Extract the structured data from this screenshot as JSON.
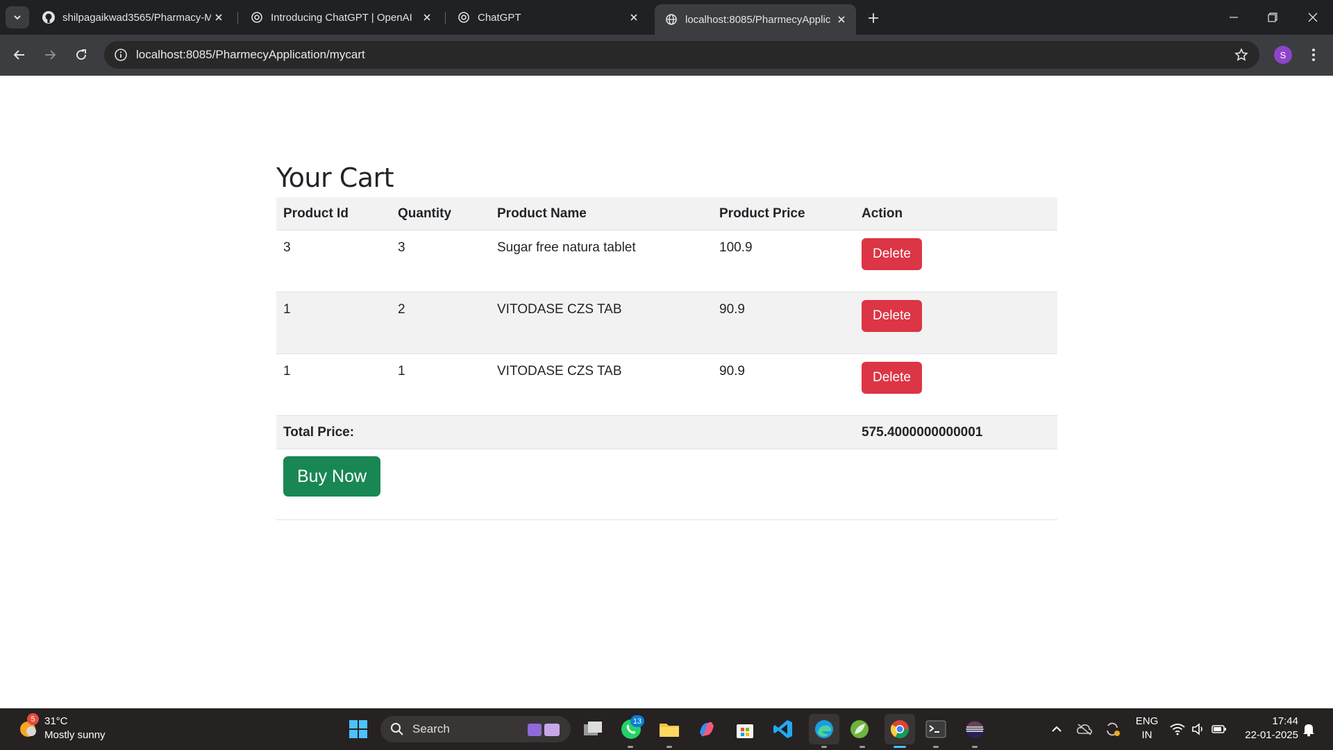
{
  "browser": {
    "tabs": [
      {
        "title": "shilpagaikwad3565/Pharmacy-M",
        "icon": "github-icon"
      },
      {
        "title": "Introducing ChatGPT | OpenAI",
        "icon": "openai-icon"
      },
      {
        "title": "ChatGPT",
        "icon": "openai-icon"
      },
      {
        "title": "localhost:8085/PharmecyApplic",
        "icon": "globe-icon"
      }
    ],
    "url": "localhost:8085/PharmecyApplication/mycart",
    "profile_initial": "S"
  },
  "cart": {
    "heading": "Your Cart",
    "columns": [
      "Product Id",
      "Quantity",
      "Product Name",
      "Product Price",
      "Action"
    ],
    "rows": [
      {
        "id": "3",
        "qty": "3",
        "name": "Sugar free natura tablet",
        "price": "100.9",
        "action": "Delete"
      },
      {
        "id": "1",
        "qty": "2",
        "name": "VITODASE CZS TAB",
        "price": "90.9",
        "action": "Delete"
      },
      {
        "id": "1",
        "qty": "1",
        "name": "VITODASE CZS TAB",
        "price": "90.9",
        "action": "Delete"
      }
    ],
    "total_label": "Total Price:",
    "total_value": "575.4000000000001",
    "buy_label": "Buy Now"
  },
  "colors": {
    "delete": "#dc3545",
    "buy": "#198754",
    "stripe": "#f2f2f2"
  },
  "taskbar": {
    "weather_badge": "5",
    "temperature": "31°C",
    "weather": "Mostly sunny",
    "search_label": "Search",
    "whatsapp_badge": "13",
    "lang_top": "ENG",
    "lang_bottom": "IN",
    "time": "17:44",
    "date": "22-01-2025"
  }
}
